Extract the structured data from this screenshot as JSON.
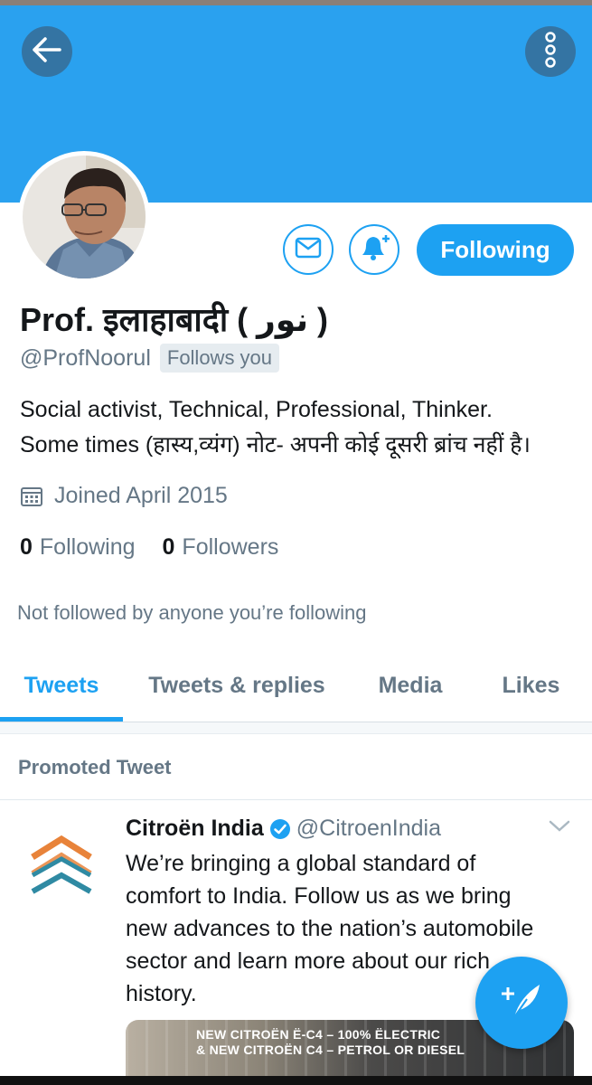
{
  "profile": {
    "name": "Prof. इलाहाबादी ( نور )",
    "handle": "@ProfNoorul",
    "follows_you": "Follows you",
    "bio_lines": [
      "Social activist, Technical, Professional, Thinker.",
      "Some times (हास्य,व्यंग) नोट- अपनी कोई दूसरी ब्रांच नहीं है।"
    ],
    "joined": "Joined April 2015",
    "following_count": "0",
    "following_label": "Following",
    "followers_count": "0",
    "followers_label": "Followers",
    "not_followed": "Not followed by anyone you’re following"
  },
  "actions": {
    "follow_label": "Following",
    "message_icon": "envelope-icon",
    "notify_icon": "bell-plus-icon",
    "back_icon": "arrow-left-icon",
    "more_icon": "vertical-dots-icon"
  },
  "tabs": [
    {
      "label": "Tweets",
      "active": true
    },
    {
      "label": "Tweets & replies",
      "active": false
    },
    {
      "label": "Media",
      "active": false
    },
    {
      "label": "Likes",
      "active": false
    }
  ],
  "promoted": {
    "label": "Promoted Tweet",
    "author": "Citroën India",
    "handle": "@CitroenIndia",
    "text_lines": [
      "We’re bringing a global standard of",
      "comfort to India. Follow us as we bring",
      "new advances to the nation’s automobile",
      "sector and learn more about our rich",
      "history."
    ],
    "media_lines": [
      "NEW CITROËN Ë-C4 – 100% ËLECTRIC",
      "& NEW CITROËN C4 – PETROL OR DIESEL"
    ]
  },
  "colors": {
    "accent": "#1da1f2",
    "banner": "#2aa1ef",
    "secondary_text": "#657786",
    "primary_text": "#14171a"
  }
}
